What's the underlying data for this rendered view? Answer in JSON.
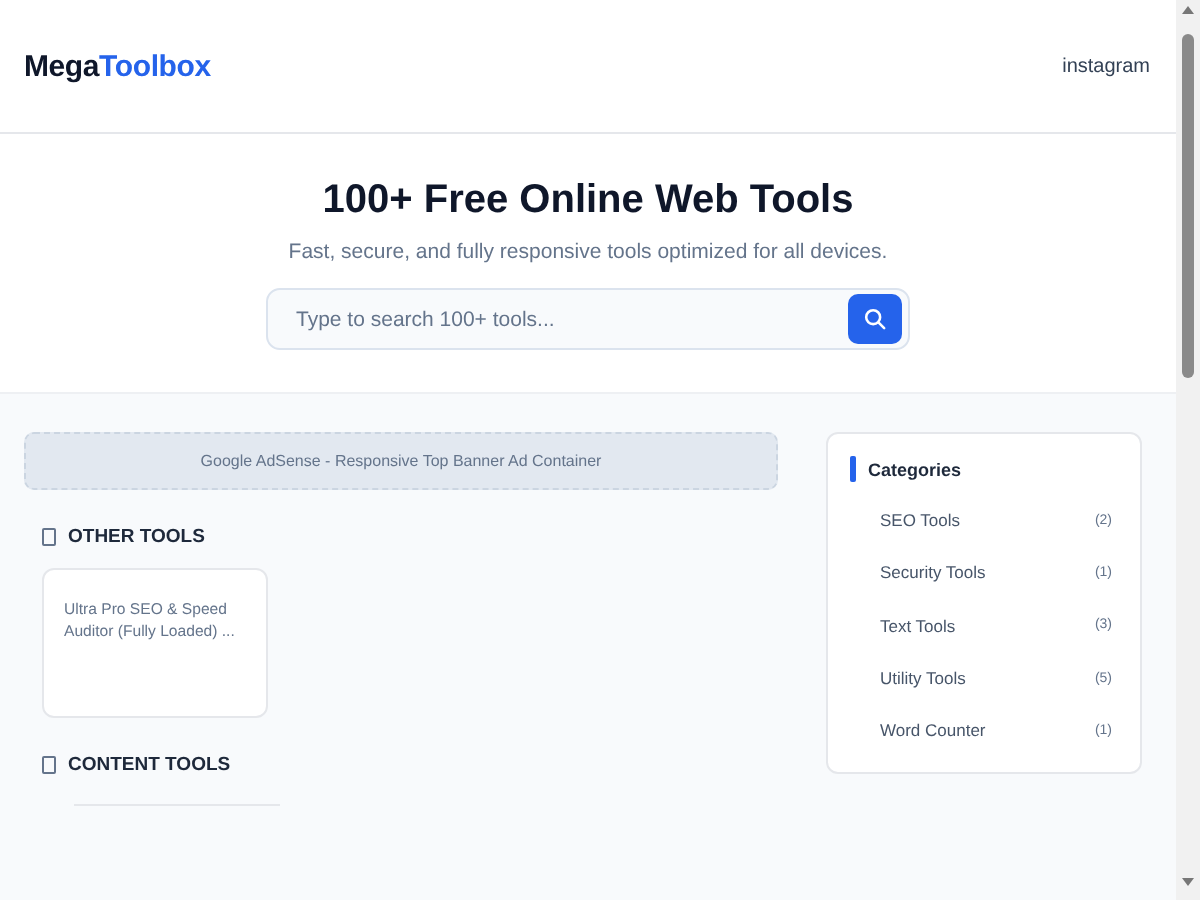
{
  "header": {
    "logo_main": "Mega",
    "logo_accent": "Toolbox",
    "nav_link": "instagram"
  },
  "hero": {
    "title": "100+ Free Online Web Tools",
    "subtitle": "Fast, secure, and fully responsive tools optimized for all devices.",
    "search": {
      "placeholder": "Type to search 100+ tools..."
    }
  },
  "ad_banner": "Google AdSense - Responsive Top Banner Ad Container",
  "sections": [
    {
      "title": "OTHER TOOLS",
      "tools": [
        "Ultra Pro SEO & Speed Auditor (Fully Loaded) ..."
      ]
    },
    {
      "title": "CONTENT TOOLS"
    }
  ],
  "categories": {
    "title": "Categories",
    "items": [
      {
        "name": "SEO Tools",
        "count": "(2)"
      },
      {
        "name": "Security Tools",
        "count": "(1)"
      },
      {
        "name": "Text Tools",
        "count": "(3)"
      },
      {
        "name": "Utility Tools",
        "count": "(5)"
      },
      {
        "name": "Word Counter",
        "count": "(1)"
      }
    ]
  }
}
